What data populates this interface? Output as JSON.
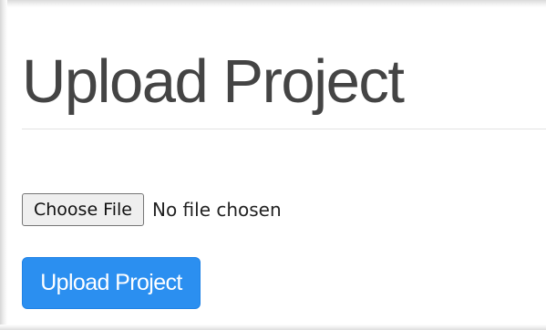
{
  "page": {
    "title": "Upload Project"
  },
  "file_input": {
    "button_label": "Choose File",
    "status_text": "No file chosen"
  },
  "actions": {
    "upload_label": "Upload Project"
  },
  "colors": {
    "title_text": "#444444",
    "divider": "#e3e3e3",
    "primary_button": "#2b8ff0",
    "primary_button_text": "#ffffff",
    "file_button_bg": "#efefef"
  }
}
